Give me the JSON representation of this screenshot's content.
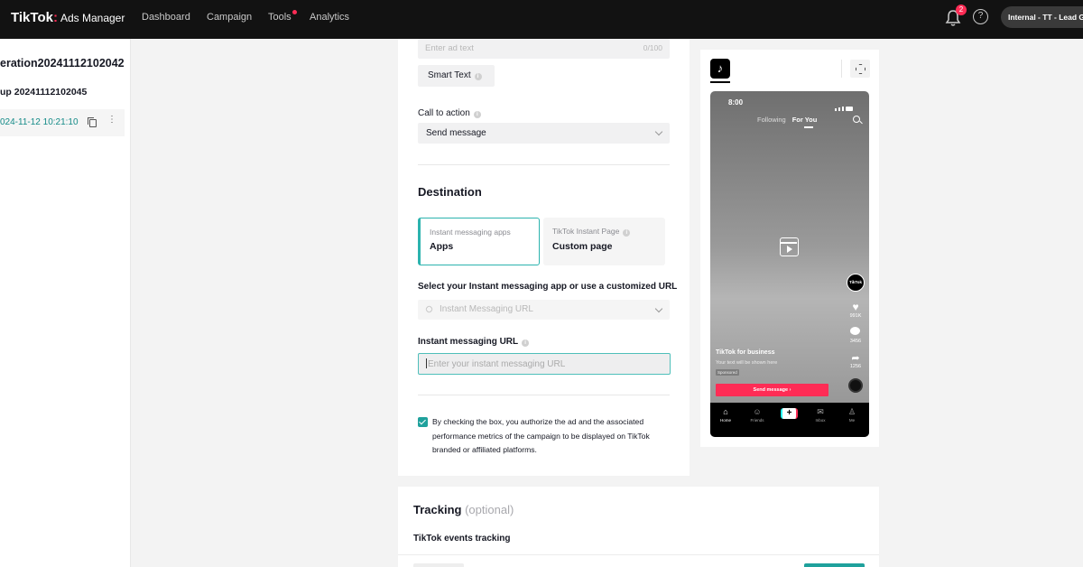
{
  "topbar": {
    "logo": "TikTok",
    "logo_dot": ":",
    "logo_sub": "Ads Manager",
    "nav": [
      "Dashboard",
      "Campaign",
      "Tools",
      "Analytics"
    ],
    "notification_count": "2",
    "help_icon": "?",
    "account": "Internal - TT - Lead Gen"
  },
  "sidebar": {
    "campaign": "eration20241112102042",
    "adgroup": "up 20241112102045",
    "ad": "024-11-12 10:21:10",
    "more": "⋮"
  },
  "form": {
    "ad_text_placeholder": "Enter ad text",
    "ad_text_count": "0/100",
    "smart_text": "Smart Text",
    "cta_label": "Call to action",
    "cta_value": "Send message",
    "destination_title": "Destination",
    "dest_options": [
      {
        "sub": "Instant messaging apps",
        "main": "Apps"
      },
      {
        "sub": "TikTok Instant Page",
        "main": "Custom page"
      }
    ],
    "select_label": "Select your Instant messaging app or use a customized URL",
    "im_placeholder": "Instant Messaging URL",
    "url_label": "Instant messaging URL",
    "url_placeholder": "Enter your instant messaging URL",
    "consent": "By checking the box, you authorize the ad and the associated performance metrics of the campaign to be displayed on TikTok branded or affiliated platforms."
  },
  "preview": {
    "logo_glyph": "♪",
    "time": "8:00",
    "tab_following": "Following",
    "tab_foryou": "For You",
    "avatar_text": "TikTok",
    "like_count": "991K",
    "comment_count": "3456",
    "share_count": "1256",
    "author": "TikTok for business",
    "caption": "Your text will be shown here",
    "sponsored": "Sponsored",
    "cta": "Send message ›",
    "nav": [
      {
        "icon": "⌂",
        "label": "Home"
      },
      {
        "icon": "☺",
        "label": "Friends"
      },
      {
        "icon": "+",
        "label": ""
      },
      {
        "icon": "✉",
        "label": "Inbox"
      },
      {
        "icon": "♙",
        "label": "Me"
      }
    ]
  },
  "tracking": {
    "title": "Tracking",
    "optional": "(optional)",
    "events": "TikTok events tracking"
  },
  "colors": {
    "accent": "#1fa19c",
    "brand": "#fe2c55",
    "topbar": "#121212"
  }
}
